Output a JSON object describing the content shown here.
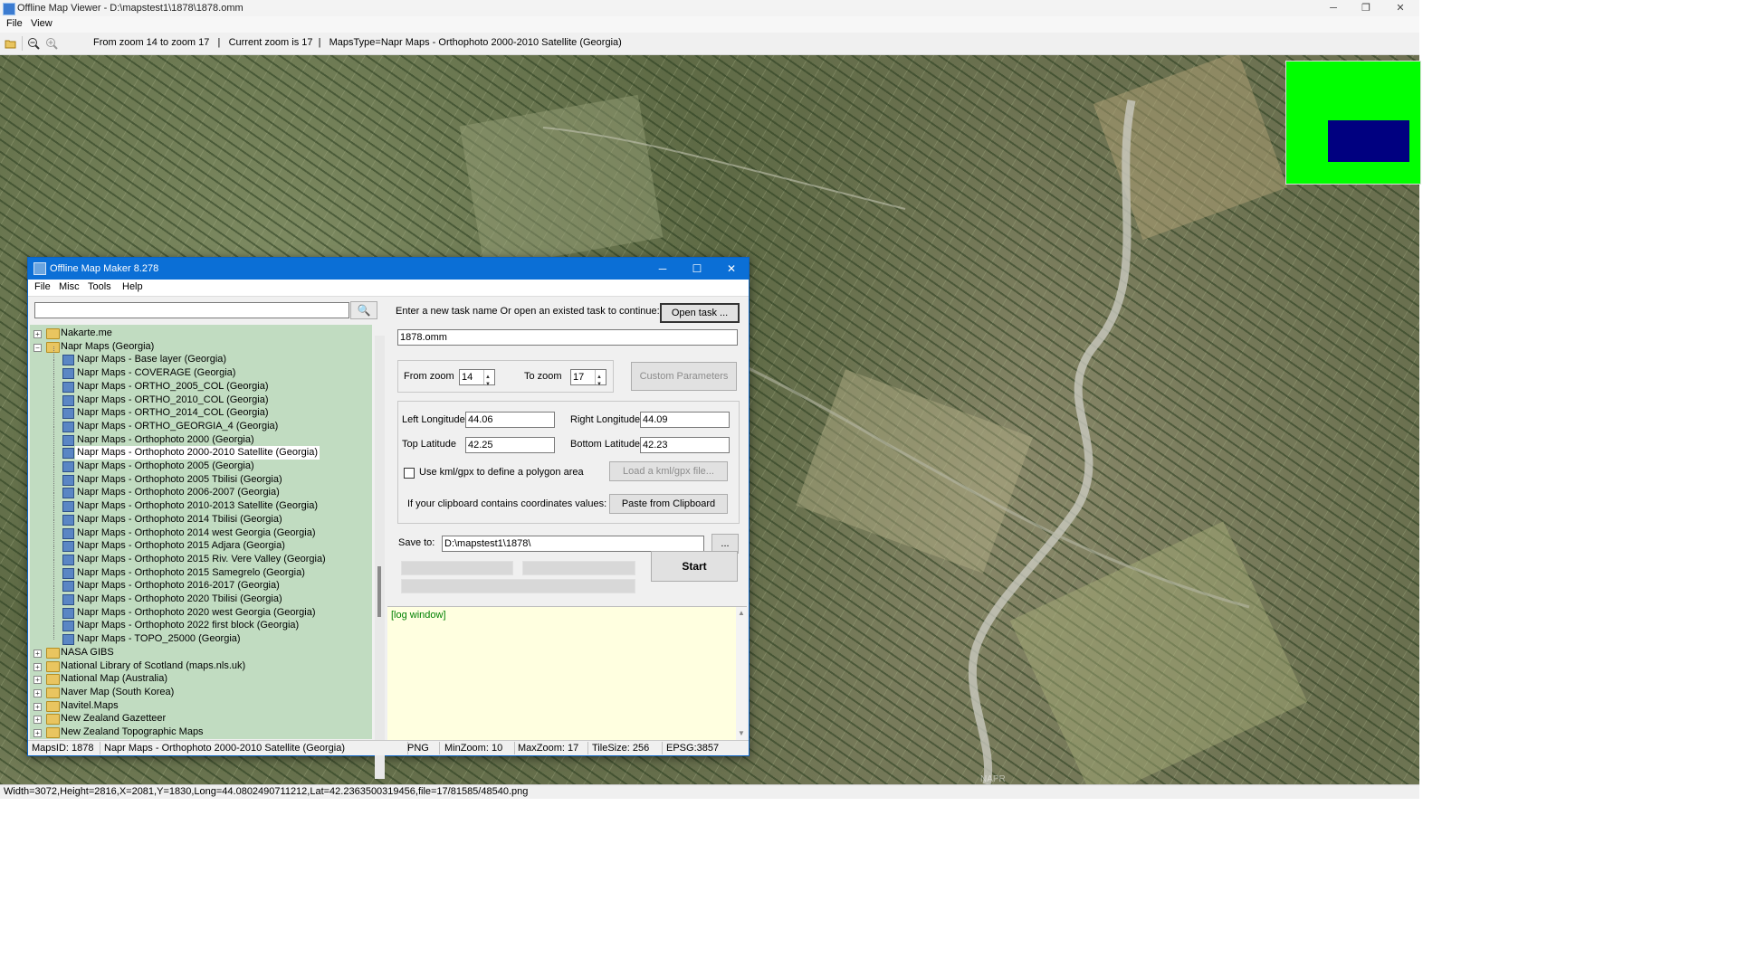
{
  "viewer": {
    "title": "Offline Map Viewer - D:\\mapstest1\\1878\\1878.omm",
    "menu": [
      "File",
      "View"
    ],
    "toolbar_status": "From zoom 14 to zoom 17   |   Current zoom is 17  |   MapsType=Napr Maps - Orthophoto 2000-2010 Satellite (Georgia)",
    "map_watermark": "NAPR",
    "status_bar": "Width=3072,Height=2816,X=2081,Y=1830,Long=44.0802490711212,Lat=42.2363500319456,file=17/81585/48540.png",
    "window_controls": {
      "minimize": "─",
      "restore": "❐",
      "close": "✕"
    },
    "icons": [
      "open-folder-icon",
      "zoom-out-icon",
      "zoom-in-icon"
    ]
  },
  "dialog": {
    "title": "Offline Map Maker 8.278",
    "menu": [
      "File",
      "Misc",
      "Tools",
      "Help"
    ],
    "window_controls": {
      "minimize": "─",
      "maximize": "☐",
      "close": "✕"
    },
    "search": {
      "value": "",
      "placeholder": ""
    },
    "tree": {
      "items": [
        {
          "label": "Nakarte.me",
          "type": "folder",
          "expanded": false
        },
        {
          "label": "Napr Maps (Georgia)",
          "type": "folder",
          "expanded": true
        },
        {
          "label": "Napr Maps - Base layer (Georgia)",
          "type": "map"
        },
        {
          "label": "Napr Maps - COVERAGE (Georgia)",
          "type": "map"
        },
        {
          "label": "Napr Maps - ORTHO_2005_COL (Georgia)",
          "type": "map"
        },
        {
          "label": "Napr Maps - ORTHO_2010_COL (Georgia)",
          "type": "map"
        },
        {
          "label": "Napr Maps - ORTHO_2014_COL (Georgia)",
          "type": "map"
        },
        {
          "label": "Napr Maps - ORTHO_GEORGIA_4 (Georgia)",
          "type": "map"
        },
        {
          "label": "Napr Maps - Orthophoto 2000 (Georgia)",
          "type": "map"
        },
        {
          "label": "Napr Maps - Orthophoto 2000-2010 Satellite (Georgia)",
          "type": "map",
          "selected": true
        },
        {
          "label": "Napr Maps - Orthophoto 2005 (Georgia)",
          "type": "map"
        },
        {
          "label": "Napr Maps - Orthophoto 2005 Tbilisi (Georgia)",
          "type": "map"
        },
        {
          "label": "Napr Maps - Orthophoto 2006-2007 (Georgia)",
          "type": "map"
        },
        {
          "label": "Napr Maps - Orthophoto 2010-2013 Satellite (Georgia)",
          "type": "map"
        },
        {
          "label": "Napr Maps - Orthophoto 2014 Tbilisi (Georgia)",
          "type": "map"
        },
        {
          "label": "Napr Maps - Orthophoto 2014 west Georgia (Georgia)",
          "type": "map"
        },
        {
          "label": "Napr Maps - Orthophoto 2015 Adjara (Georgia)",
          "type": "map"
        },
        {
          "label": "Napr Maps - Orthophoto 2015 Riv. Vere Valley (Georgia)",
          "type": "map"
        },
        {
          "label": "Napr Maps - Orthophoto 2015 Samegrelo (Georgia)",
          "type": "map"
        },
        {
          "label": "Napr Maps - Orthophoto 2016-2017 (Georgia)",
          "type": "map"
        },
        {
          "label": "Napr Maps - Orthophoto 2020 Tbilisi (Georgia)",
          "type": "map"
        },
        {
          "label": "Napr Maps - Orthophoto 2020 west Georgia (Georgia)",
          "type": "map"
        },
        {
          "label": "Napr Maps - Orthophoto 2022 first block (Georgia)",
          "type": "map"
        },
        {
          "label": "Napr Maps - TOPO_25000 (Georgia)",
          "type": "map"
        },
        {
          "label": "NASA GIBS",
          "type": "folder",
          "expanded": false
        },
        {
          "label": "National Library of Scotland (maps.nls.uk)",
          "type": "folder",
          "expanded": false
        },
        {
          "label": "National Map (Australia)",
          "type": "folder",
          "expanded": false
        },
        {
          "label": "Naver Map (South Korea)",
          "type": "folder",
          "expanded": false
        },
        {
          "label": "Navitel.Maps",
          "type": "folder",
          "expanded": false
        },
        {
          "label": "New Zealand Gazetteer",
          "type": "folder",
          "expanded": false
        },
        {
          "label": "New Zealand Topographic Maps",
          "type": "folder",
          "expanded": false
        }
      ]
    },
    "task": {
      "prompt": "Enter a new task name Or open an existed task to continue:",
      "open_button": "Open task ...",
      "name_value": "1878.omm"
    },
    "zoom": {
      "from_label": "From zoom",
      "from_value": "14",
      "to_label": "To zoom",
      "to_value": "17",
      "custom_button": "Custom Parameters"
    },
    "coords": {
      "left_lon_label": "Left Longitude",
      "left_lon_value": "44.06",
      "right_lon_label": "Right Longitude",
      "right_lon_value": "44.09",
      "top_lat_label": "Top Latitude",
      "top_lat_value": "42.25",
      "bottom_lat_label": "Bottom Latitude",
      "bottom_lat_value": "42.23",
      "kml_checkbox_label": "Use kml/gpx to define a polygon area",
      "kml_checked": false,
      "load_kml_button": "Load a kml/gpx file...",
      "clipboard_label": "If your clipboard contains coordinates values:",
      "paste_button": "Paste from Clipboard"
    },
    "save": {
      "label": "Save to:",
      "value": "D:\\mapstest1\\1878\\",
      "browse_button": "...",
      "start_button": "Start"
    },
    "log": {
      "label": "[log window]"
    },
    "status": {
      "maps_id": "MapsID: 1878",
      "maps_name": "Napr Maps - Orthophoto 2000-2010 Satellite (Georgia)",
      "format": "PNG",
      "min_zoom": "MinZoom: 10",
      "max_zoom": "MaxZoom: 17",
      "tile_size": "TileSize: 256",
      "epsg": "EPSG:3857"
    }
  },
  "colors": {
    "dialog_titlebar": "#0b6fd6",
    "tree_background": "#c1dcc1",
    "log_background": "#ffffe0",
    "minimap_green": "#00ff00",
    "minimap_view": "#000080"
  }
}
